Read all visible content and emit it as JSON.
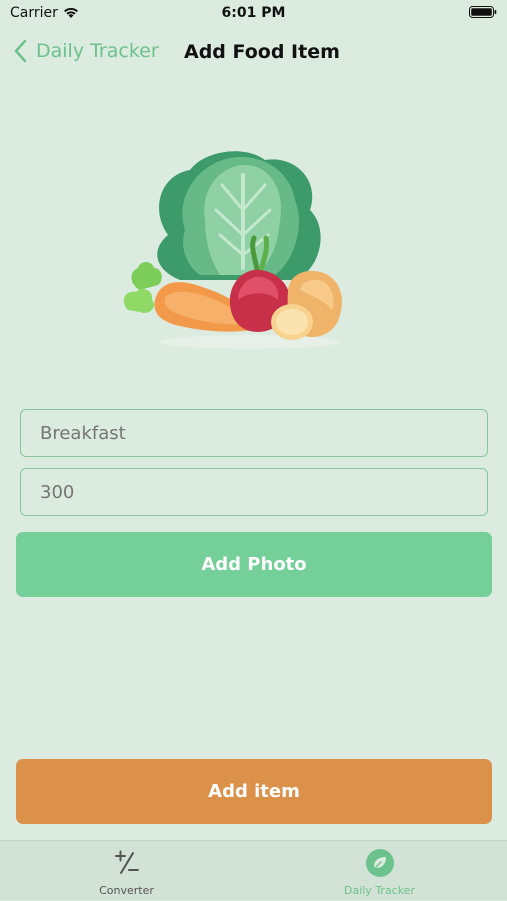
{
  "status_bar": {
    "carrier": "Carrier",
    "time": "6:01 PM",
    "wifi_icon": "wifi-icon",
    "battery_icon": "battery-icon"
  },
  "nav": {
    "back_label": "Daily Tracker",
    "title": "Add Food Item"
  },
  "hero": {
    "illustration": "vegetables-illustration"
  },
  "form": {
    "food_placeholder": "Breakfast",
    "calories_placeholder": "300"
  },
  "actions": {
    "add_photo": "Add Photo",
    "add_item": "Add item"
  },
  "tab_bar": {
    "items": [
      {
        "label": "Converter",
        "icon": "plus-minus-icon"
      },
      {
        "label": "Daily Tracker",
        "icon": "leaf-icon",
        "selected": true
      }
    ]
  },
  "colors": {
    "background": "#dcebdf",
    "accent_green": "#6cc28d",
    "photo_button": "#74cf98",
    "add_button": "#dc914b"
  }
}
